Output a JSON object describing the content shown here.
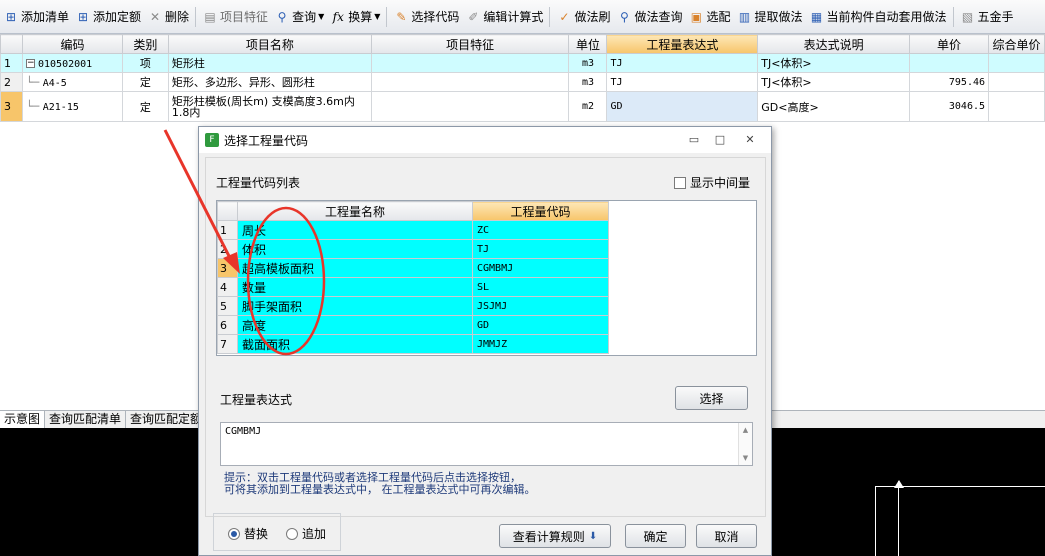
{
  "toolbar": {
    "items": [
      {
        "label": "添加清单",
        "icon": "add-list-icon"
      },
      {
        "label": "添加定额",
        "icon": "add-quota-icon"
      },
      {
        "label": "删除",
        "icon": "delete-icon"
      },
      {
        "label": "项目特征",
        "icon": "features-icon"
      },
      {
        "label": "查询",
        "icon": "search-icon"
      },
      {
        "label": "换算",
        "icon": "fx-icon"
      },
      {
        "label": "选择代码",
        "icon": "select-code-icon"
      },
      {
        "label": "编辑计算式",
        "icon": "edit-formula-icon"
      },
      {
        "label": "做法刷",
        "icon": "brush-icon"
      },
      {
        "label": "做法查询",
        "icon": "method-search-icon"
      },
      {
        "label": "选配",
        "icon": "match-icon"
      },
      {
        "label": "提取做法",
        "icon": "extract-icon"
      },
      {
        "label": "当前构件自动套用做法",
        "icon": "auto-apply-icon"
      },
      {
        "label": "五金手",
        "icon": "hardware-icon"
      }
    ]
  },
  "main_table": {
    "headers": [
      "编码",
      "类别",
      "项目名称",
      "项目特征",
      "单位",
      "工程量表达式",
      "表达式说明",
      "单价",
      "综合单价"
    ],
    "rows": [
      {
        "num": "1",
        "code": "010502001",
        "type": "项",
        "name": "矩形柱",
        "feature": "",
        "unit": "m3",
        "expr": "TJ",
        "desc": "TJ<体积>",
        "price": "",
        "total": ""
      },
      {
        "num": "2",
        "code": "A4-5",
        "type": "定",
        "name": "矩形、多边形、异形、圆形柱",
        "feature": "",
        "unit": "m3",
        "expr": "TJ",
        "desc": "TJ<体积>",
        "price": "795.46",
        "total": ""
      },
      {
        "num": "3",
        "code": "A21-15",
        "type": "定",
        "name": "矩形柱模板(周长m) 支模高度3.6m内",
        "name2": "1.8内",
        "feature": "",
        "unit": "m2",
        "expr": "GD",
        "desc": "GD<高度>",
        "price": "3046.5",
        "total": ""
      }
    ]
  },
  "bottom_tabs": [
    "示意图",
    "查询匹配清单",
    "查询匹配定额"
  ],
  "dialog": {
    "title": "选择工程量代码",
    "list_label": "工程量代码列表",
    "show_intermediate": "显示中间量",
    "col_name": "工程量名称",
    "col_code": "工程量代码",
    "rows": [
      {
        "num": "1",
        "name": "周长",
        "code": "ZC"
      },
      {
        "num": "2",
        "name": "体积",
        "code": "TJ"
      },
      {
        "num": "3",
        "name": "超高模板面积",
        "code": "CGMBMJ"
      },
      {
        "num": "4",
        "name": "数量",
        "code": "SL"
      },
      {
        "num": "5",
        "name": "脚手架面积",
        "code": "JSJMJ"
      },
      {
        "num": "6",
        "name": "高度",
        "code": "GD"
      },
      {
        "num": "7",
        "name": "截面面积",
        "code": "JMMJZ"
      }
    ],
    "expr_label": "工程量表达式",
    "select_button": "选择",
    "expr_value": "CGMBMJ",
    "hint_line1": "提示：双击工程量代码或者选择工程量代码后点击选择按钮，",
    "hint_line2": "可将其添加到工程量表达式中， 在工程量表达式中可再次编辑。",
    "radio_replace": "替换",
    "radio_append": "追加",
    "calc_rules_button": "查看计算规则",
    "ok_button": "确定",
    "cancel_button": "取消"
  },
  "colors": {
    "highlight_cyan": "#00ffff",
    "header_orange": "#f7c56a",
    "annotation_red": "#e8352a"
  }
}
